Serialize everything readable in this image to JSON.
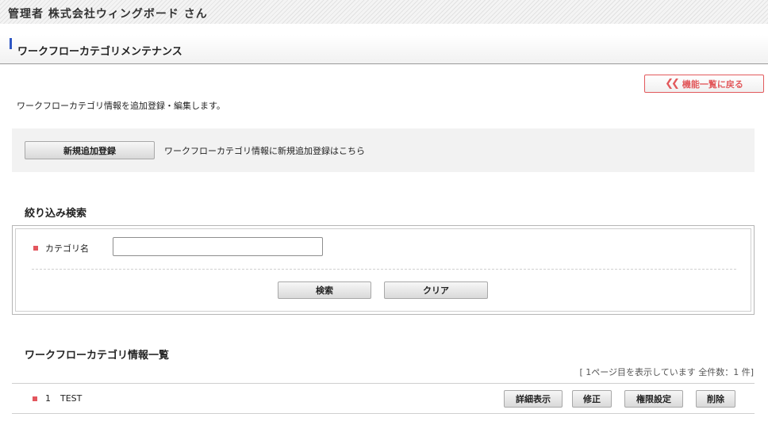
{
  "header": {
    "admin_text": "管理者 株式会社ウィングボード さん"
  },
  "page": {
    "title": "ワークフローカテゴリメンテナンス",
    "back_label": "機能一覧に戻る",
    "description": "ワークフローカテゴリ情報を追加登録・編集します。"
  },
  "new_area": {
    "button_label": "新規追加登録",
    "text": "ワークフローカテゴリ情報に新規追加登録はこちら"
  },
  "search": {
    "title": "絞り込み検索",
    "category_label": "カテゴリ名",
    "category_value": "",
    "search_label": "検索",
    "clear_label": "クリア"
  },
  "list": {
    "title": "ワークフローカテゴリ情報一覧",
    "paging": "[ 1ページ目を表示しています 全件数：1 件]",
    "rows": [
      {
        "num": "1",
        "name": "TEST"
      }
    ],
    "actions": {
      "detail": "詳細表示",
      "edit": "修正",
      "permission": "権限設定",
      "delete": "削除"
    }
  },
  "colors": {
    "accent_blue": "#2f57c4",
    "accent_red": "#e2595c"
  }
}
